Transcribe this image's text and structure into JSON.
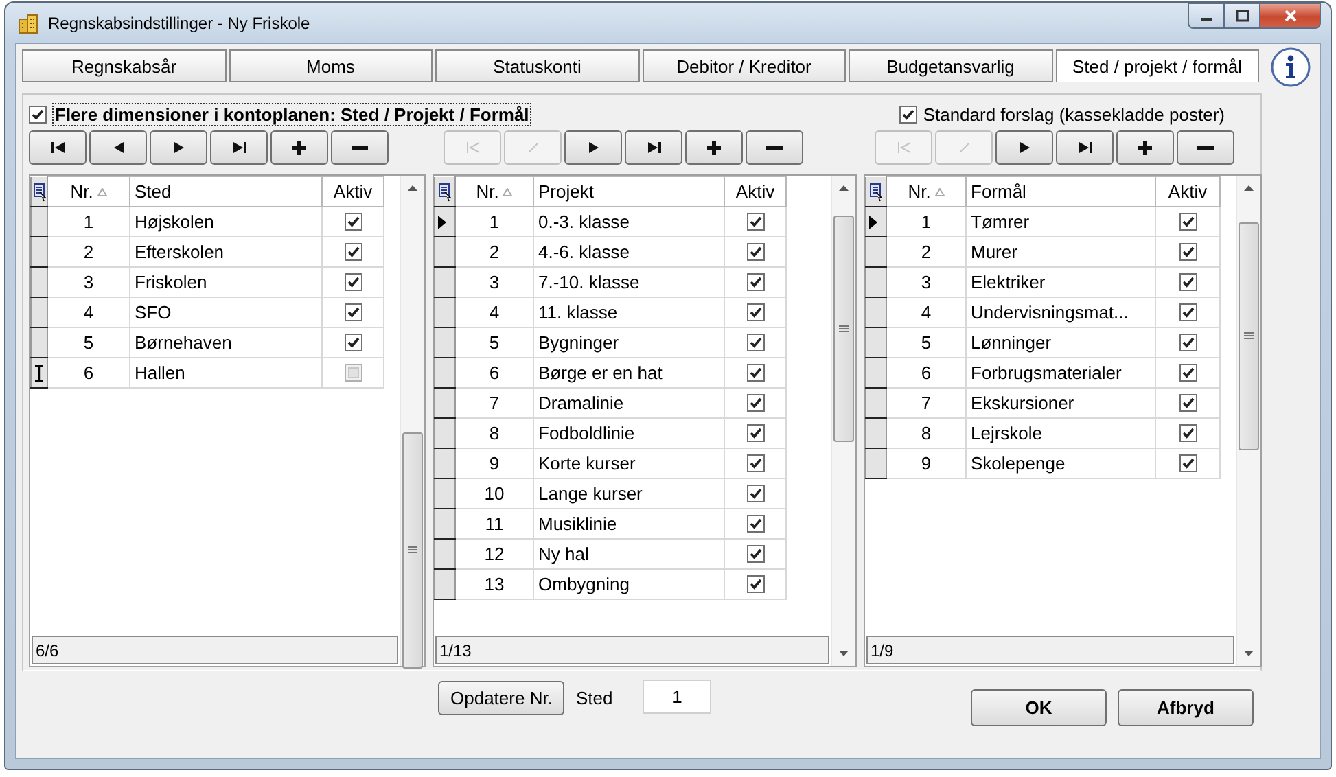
{
  "window": {
    "title": "Regnskabsindstillinger - Ny Friskole"
  },
  "tabs": [
    {
      "label": "Regnskabsår",
      "selected": false
    },
    {
      "label": "Moms",
      "selected": false
    },
    {
      "label": "Statuskonti",
      "selected": false
    },
    {
      "label": "Debitor / Kreditor",
      "selected": false
    },
    {
      "label": "Budgetansvarlig",
      "selected": false
    },
    {
      "label": "Sted / projekt / formål",
      "selected": true
    }
  ],
  "dimensions_checkbox": {
    "label": "Flere dimensioner i kontoplanen: Sted / Projekt / Formål",
    "checked": true
  },
  "standard_checkbox": {
    "label": "Standard forslag (kassekladde poster)",
    "checked": true
  },
  "grids": [
    {
      "navigator": [
        {
          "kind": "first",
          "disabled": false
        },
        {
          "kind": "prev",
          "disabled": false
        },
        {
          "kind": "next",
          "disabled": false
        },
        {
          "kind": "last",
          "disabled": false
        },
        {
          "kind": "add",
          "disabled": false
        },
        {
          "kind": "remove",
          "disabled": false
        }
      ],
      "columns": [
        "Nr.",
        "Sted",
        "Aktiv"
      ],
      "rows": [
        {
          "nr": "1",
          "name": "Højskolen",
          "active": true,
          "current": false,
          "editing": false
        },
        {
          "nr": "2",
          "name": "Efterskolen",
          "active": true,
          "current": false,
          "editing": false
        },
        {
          "nr": "3",
          "name": "Friskolen",
          "active": true,
          "current": false,
          "editing": false
        },
        {
          "nr": "4",
          "name": "SFO",
          "active": true,
          "current": false,
          "editing": false
        },
        {
          "nr": "5",
          "name": "Børnehaven",
          "active": true,
          "current": false,
          "editing": false
        },
        {
          "nr": "6",
          "name": "Hallen",
          "active": false,
          "current": false,
          "editing": true
        }
      ],
      "record_count": "6/6"
    },
    {
      "navigator": [
        {
          "kind": "first",
          "disabled": true
        },
        {
          "kind": "prev",
          "disabled": true
        },
        {
          "kind": "next",
          "disabled": false
        },
        {
          "kind": "last",
          "disabled": false
        },
        {
          "kind": "add",
          "disabled": false
        },
        {
          "kind": "remove",
          "disabled": false
        }
      ],
      "columns": [
        "Nr.",
        "Projekt",
        "Aktiv"
      ],
      "rows": [
        {
          "nr": "1",
          "name": "0.-3. klasse",
          "active": true,
          "current": true,
          "editing": false
        },
        {
          "nr": "2",
          "name": "4.-6. klasse",
          "active": true,
          "current": false,
          "editing": false
        },
        {
          "nr": "3",
          "name": "7.-10. klasse",
          "active": true,
          "current": false,
          "editing": false
        },
        {
          "nr": "4",
          "name": "11. klasse",
          "active": true,
          "current": false,
          "editing": false
        },
        {
          "nr": "5",
          "name": "Bygninger",
          "active": true,
          "current": false,
          "editing": false
        },
        {
          "nr": "6",
          "name": "Børge er en hat",
          "active": true,
          "current": false,
          "editing": false
        },
        {
          "nr": "7",
          "name": "Dramalinie",
          "active": true,
          "current": false,
          "editing": false
        },
        {
          "nr": "8",
          "name": "Fodboldlinie",
          "active": true,
          "current": false,
          "editing": false
        },
        {
          "nr": "9",
          "name": "Korte kurser",
          "active": true,
          "current": false,
          "editing": false
        },
        {
          "nr": "10",
          "name": "Lange kurser",
          "active": true,
          "current": false,
          "editing": false
        },
        {
          "nr": "11",
          "name": "Musiklinie",
          "active": true,
          "current": false,
          "editing": false
        },
        {
          "nr": "12",
          "name": "Ny hal",
          "active": true,
          "current": false,
          "editing": false
        },
        {
          "nr": "13",
          "name": "Ombygning",
          "active": true,
          "current": false,
          "editing": false
        }
      ],
      "record_count": "1/13"
    },
    {
      "navigator": [
        {
          "kind": "first",
          "disabled": true
        },
        {
          "kind": "prev",
          "disabled": true
        },
        {
          "kind": "next",
          "disabled": false
        },
        {
          "kind": "last",
          "disabled": false
        },
        {
          "kind": "add",
          "disabled": false
        },
        {
          "kind": "remove",
          "disabled": false
        }
      ],
      "columns": [
        "Nr.",
        "Formål",
        "Aktiv"
      ],
      "rows": [
        {
          "nr": "1",
          "name": "Tømrer",
          "active": true,
          "current": true,
          "editing": false
        },
        {
          "nr": "2",
          "name": "Murer",
          "active": true,
          "current": false,
          "editing": false
        },
        {
          "nr": "3",
          "name": "Elektriker",
          "active": true,
          "current": false,
          "editing": false
        },
        {
          "nr": "4",
          "name": "Undervisningsmat...",
          "active": true,
          "current": false,
          "editing": false
        },
        {
          "nr": "5",
          "name": "Lønninger",
          "active": true,
          "current": false,
          "editing": false
        },
        {
          "nr": "6",
          "name": "Forbrugsmaterialer",
          "active": true,
          "current": false,
          "editing": false
        },
        {
          "nr": "7",
          "name": "Ekskursioner",
          "active": true,
          "current": false,
          "editing": false
        },
        {
          "nr": "8",
          "name": "Lejrskole",
          "active": true,
          "current": false,
          "editing": false
        },
        {
          "nr": "9",
          "name": "Skolepenge",
          "active": true,
          "current": false,
          "editing": false
        }
      ],
      "record_count": "1/9"
    }
  ],
  "bottom": {
    "update_button": "Opdatere Nr.",
    "field_label": "Sted",
    "field_value": "1",
    "ok_button": "OK",
    "cancel_button": "Afbryd"
  }
}
